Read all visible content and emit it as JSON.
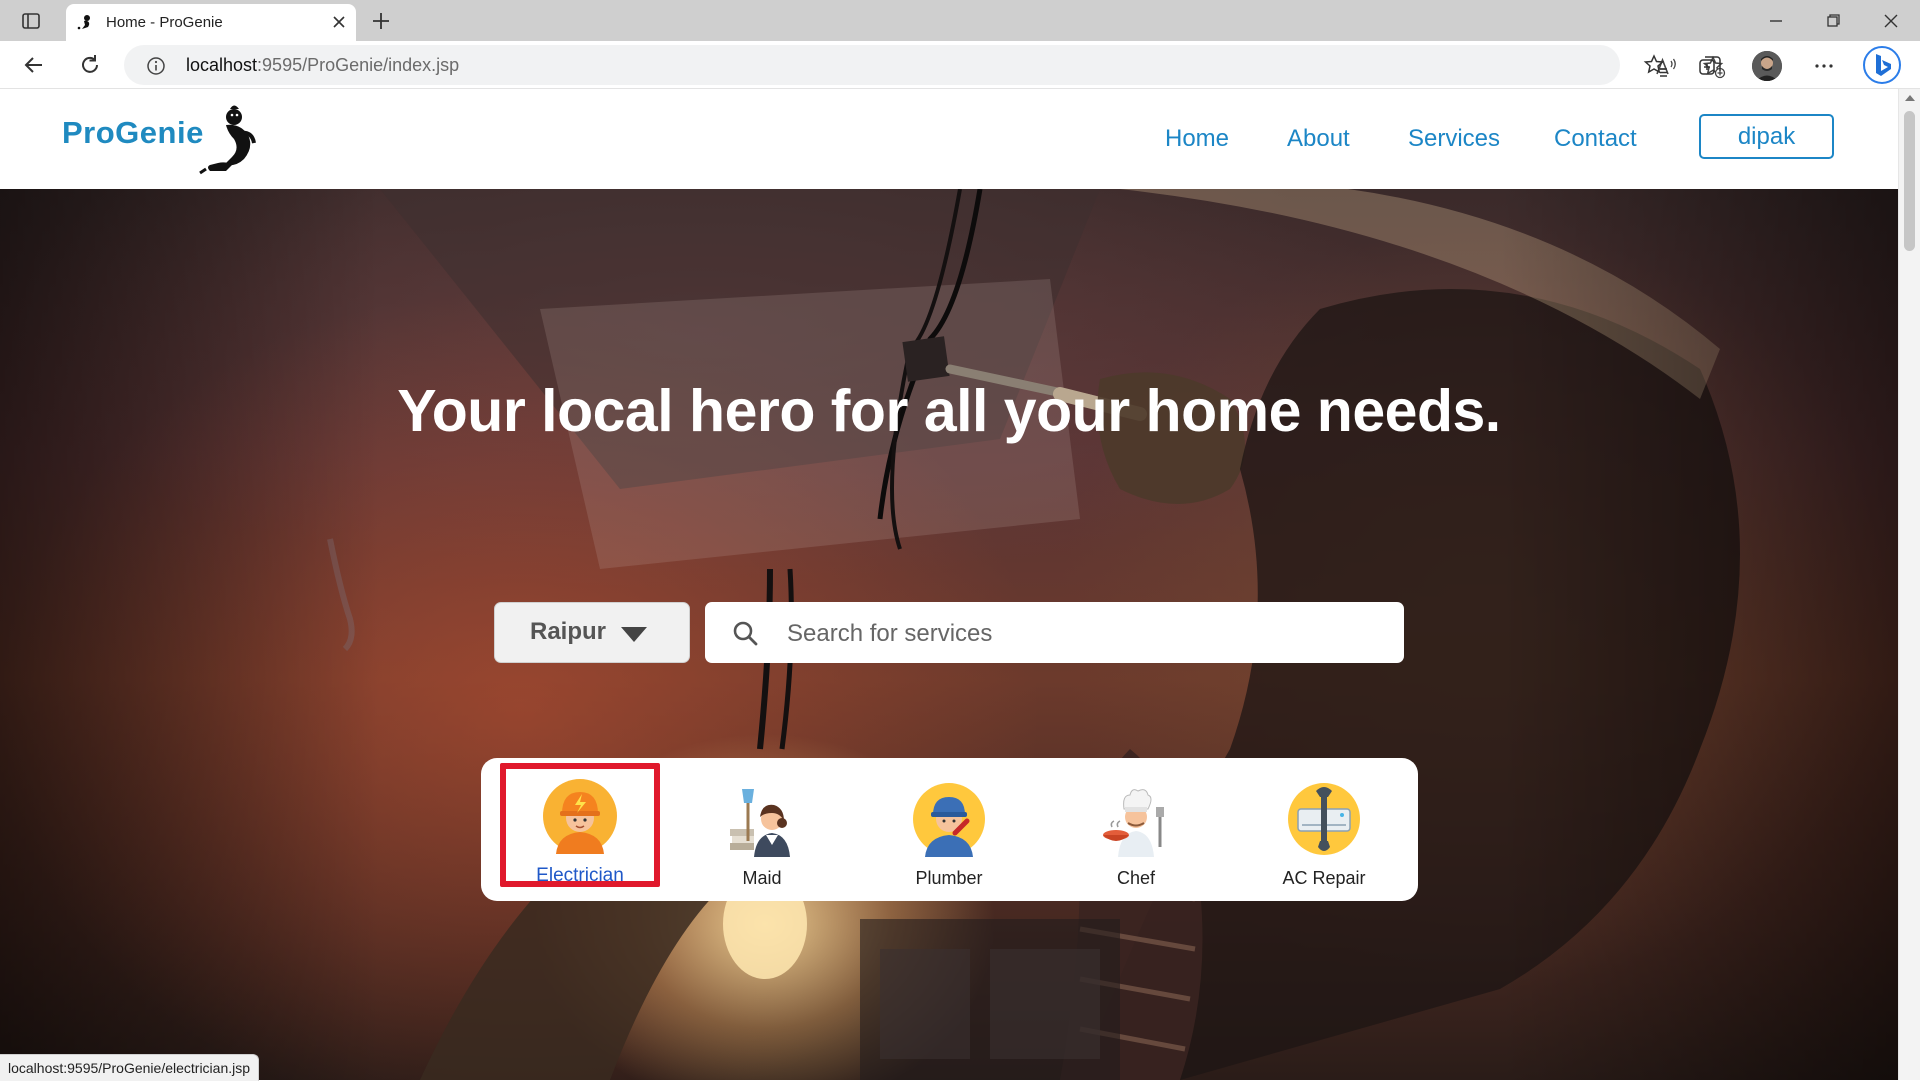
{
  "browser": {
    "tab_title": "Home - ProGenie",
    "url_host": "localhost",
    "url_path": ":9595/ProGenie/index.jsp"
  },
  "header": {
    "logo": "ProGenie",
    "nav": {
      "home": "Home",
      "about": "About",
      "services": "Services",
      "contact": "Contact"
    },
    "user_button": "dipak"
  },
  "hero": {
    "headline": "Your local hero for all your home needs.",
    "city": "Raipur",
    "search_placeholder": "Search for services"
  },
  "categories": [
    {
      "label": "Electrician",
      "icon": "electrician-icon",
      "selected": true
    },
    {
      "label": "Maid",
      "icon": "maid-icon",
      "selected": false
    },
    {
      "label": "Plumber",
      "icon": "plumber-icon",
      "selected": false
    },
    {
      "label": "Chef",
      "icon": "chef-icon",
      "selected": false
    },
    {
      "label": "AC Repair",
      "icon": "ac-repair-icon",
      "selected": false
    }
  ],
  "status_bar": {
    "hover_url": "localhost:9595/ProGenie/electrician.jsp"
  },
  "colors": {
    "brand": "#1f8ac0",
    "nav_link": "#1c86c6",
    "highlight_border": "#e0192c"
  }
}
